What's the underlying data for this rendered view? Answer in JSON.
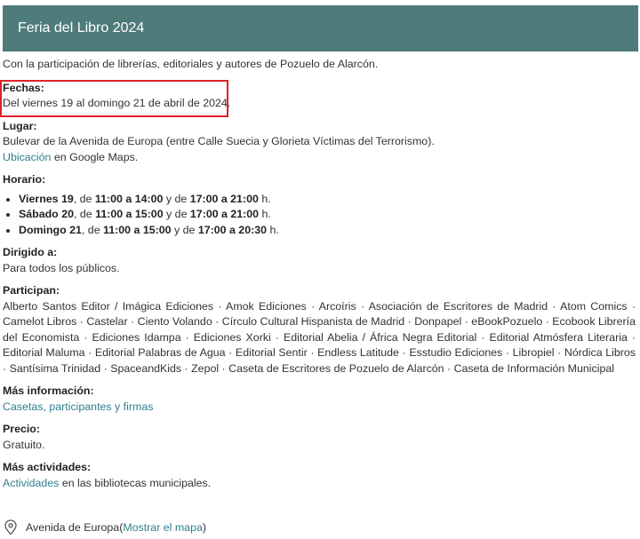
{
  "colors": {
    "header_bg": "#4e7c7a",
    "link": "#2f7f8f",
    "highlight": "#e0202a"
  },
  "header": {
    "title": "Feria del Libro 2024"
  },
  "intro": "Con la participación de librerías, editoriales y autores de Pozuelo de Alarcón.",
  "fechas": {
    "label": "Fechas:",
    "value": "Del viernes 19 al domingo 21 de abril de 2024."
  },
  "lugar": {
    "label": "Lugar:",
    "value": "Bulevar de la Avenida de Europa (entre Calle Suecia y Glorieta Víctimas del Terrorismo).",
    "link": "Ubicación",
    "link_suffix": " en Google Maps."
  },
  "horario": {
    "label": "Horario:",
    "items": [
      {
        "day": "Viernes 19",
        "s1": ", de ",
        "t1": "11:00 a 14:00",
        "s2": " y de ",
        "t2": "17:00 a 21:00",
        "s3": " h."
      },
      {
        "day": "Sábado 20",
        "s1": ", de ",
        "t1": "11:00 a 15:00",
        "s2": " y de ",
        "t2": "17:00 a 21:00",
        "s3": " h."
      },
      {
        "day": "Domingo 21",
        "s1": ", de ",
        "t1": "11:00 a 15:00",
        "s2": " y de ",
        "t2": "17:00 a 20:30",
        "s3": " h."
      }
    ]
  },
  "dirigido": {
    "label": "Dirigido a:",
    "value": "Para todos los públicos."
  },
  "participan": {
    "label": "Participan:",
    "value": "Alberto Santos Editor / Imágica Ediciones · Amok Ediciones · Arcoíris · Asociación de Escritores de Madrid · Atom Comics · Camelot Libros · Castelar · Ciento Volando · Círculo Cultural Hispanista de Madrid · Donpapel · eBookPozuelo · Ecobook Librería del Economista · Ediciones Idampa · Ediciones Xorki · Editorial Abelia / África Negra Editorial · Editorial Atmósfera Literaria · Editorial Maluma · Editorial Palabras de Agua · Editorial Sentir · Endless Latitude · Esstudio Ediciones · Libropiel · Nórdica Libros · Santísima Trinidad · SpaceandKids · Zepol · Caseta de Escritores de Pozuelo de Alarcón · Caseta de Información Municipal"
  },
  "mas_info": {
    "label": "Más información:",
    "link": "Casetas, participantes y firmas"
  },
  "precio": {
    "label": "Precio:",
    "value": "Gratuito."
  },
  "mas_act": {
    "label": "Más actividades:",
    "link": "Actividades",
    "link_suffix": " en las bibliotecas municipales."
  },
  "location": {
    "place": "Avenida de Europa",
    "open_paren": " (",
    "map_link": "Mostrar el mapa",
    "close_paren": ")"
  }
}
